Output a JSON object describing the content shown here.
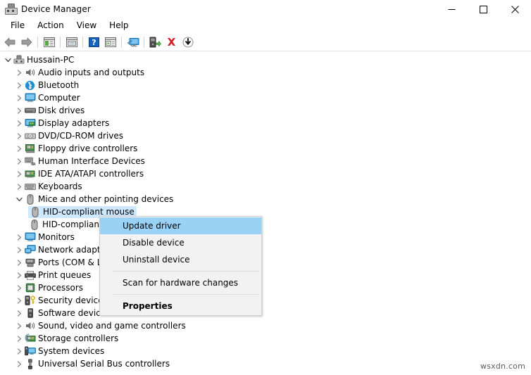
{
  "window": {
    "title": "Device Manager",
    "icon": "device-manager-icon",
    "controls": {
      "minimize": "minimize-icon",
      "maximize": "maximize-icon",
      "close": "close-icon"
    }
  },
  "menubar": {
    "items": [
      {
        "label": "File"
      },
      {
        "label": "Action"
      },
      {
        "label": "View"
      },
      {
        "label": "Help"
      }
    ]
  },
  "toolbar": {
    "buttons": [
      {
        "name": "back-arrow-icon",
        "type": "back"
      },
      {
        "name": "forward-arrow-icon",
        "type": "forward"
      },
      {
        "name": "separator-1",
        "type": "sep"
      },
      {
        "name": "show-hidden-devices-icon",
        "type": "list-green"
      },
      {
        "name": "separator-2",
        "type": "sep"
      },
      {
        "name": "properties-icon",
        "type": "properties"
      },
      {
        "name": "separator-3",
        "type": "sep"
      },
      {
        "name": "help-icon",
        "type": "help"
      },
      {
        "name": "view-devices-icon",
        "type": "list-play"
      },
      {
        "name": "separator-4",
        "type": "sep"
      },
      {
        "name": "scan-for-hardware-changes-icon",
        "type": "monitor-scan"
      },
      {
        "name": "separator-5",
        "type": "sep"
      },
      {
        "name": "update-driver-icon",
        "type": "update-driver"
      },
      {
        "name": "uninstall-device-icon",
        "type": "red-x"
      },
      {
        "name": "disable-device-icon",
        "type": "down-arrow"
      }
    ]
  },
  "tree": {
    "root": {
      "label": "Hussain-PC",
      "icon": "computer-node-icon",
      "expanded": true
    },
    "nodes": [
      {
        "label": "Audio inputs and outputs",
        "icon": "speaker-icon",
        "depth": 1,
        "expanded": false
      },
      {
        "label": "Bluetooth",
        "icon": "bluetooth-icon",
        "depth": 1,
        "expanded": false
      },
      {
        "label": "Computer",
        "icon": "monitor-icon",
        "depth": 1,
        "expanded": false
      },
      {
        "label": "Disk drives",
        "icon": "disk-drive-icon",
        "depth": 1,
        "expanded": false
      },
      {
        "label": "Display adapters",
        "icon": "display-adapter-icon",
        "depth": 1,
        "expanded": false
      },
      {
        "label": "DVD/CD-ROM drives",
        "icon": "dvd-drive-icon",
        "depth": 1,
        "expanded": false
      },
      {
        "label": "Floppy drive controllers",
        "icon": "floppy-controller-icon",
        "depth": 1,
        "expanded": false
      },
      {
        "label": "Human Interface Devices",
        "icon": "hid-icon",
        "depth": 1,
        "expanded": false
      },
      {
        "label": "IDE ATA/ATAPI controllers",
        "icon": "ide-controller-icon",
        "depth": 1,
        "expanded": false
      },
      {
        "label": "Keyboards",
        "icon": "keyboard-icon",
        "depth": 1,
        "expanded": false
      },
      {
        "label": "Mice and other pointing devices",
        "icon": "mouse-icon",
        "depth": 1,
        "expanded": true
      },
      {
        "label": "HID-compliant mouse",
        "icon": "mouse-icon",
        "depth": 2,
        "expanded": false,
        "selected": true
      },
      {
        "label": "HID-compliant mouse",
        "icon": "mouse-icon",
        "depth": 2,
        "expanded": false
      },
      {
        "label": "Monitors",
        "icon": "monitor-icon",
        "depth": 1,
        "expanded": false
      },
      {
        "label": "Network adapters",
        "icon": "network-adapter-icon",
        "depth": 1,
        "expanded": false
      },
      {
        "label": "Ports (COM & LPT)",
        "icon": "port-icon",
        "depth": 1,
        "expanded": false
      },
      {
        "label": "Print queues",
        "icon": "printer-icon",
        "depth": 1,
        "expanded": false
      },
      {
        "label": "Processors",
        "icon": "processor-icon",
        "depth": 1,
        "expanded": false
      },
      {
        "label": "Security devices",
        "icon": "security-device-icon",
        "depth": 1,
        "expanded": false
      },
      {
        "label": "Software devices",
        "icon": "software-device-icon",
        "depth": 1,
        "expanded": false
      },
      {
        "label": "Sound, video and game controllers",
        "icon": "speaker-icon",
        "depth": 1,
        "expanded": false
      },
      {
        "label": "Storage controllers",
        "icon": "storage-controller-icon",
        "depth": 1,
        "expanded": false
      },
      {
        "label": "System devices",
        "icon": "system-device-icon",
        "depth": 1,
        "expanded": false
      },
      {
        "label": "Universal Serial Bus controllers",
        "icon": "usb-icon",
        "depth": 1,
        "expanded": false
      }
    ]
  },
  "context_menu": {
    "items": [
      {
        "label": "Update driver",
        "highlight": true,
        "bold": false
      },
      {
        "label": "Disable device",
        "highlight": false,
        "bold": false
      },
      {
        "label": "Uninstall device",
        "highlight": false,
        "bold": false
      },
      {
        "label": "__sep__"
      },
      {
        "label": "Scan for hardware changes",
        "highlight": false,
        "bold": false
      },
      {
        "label": "__sep__"
      },
      {
        "label": "Properties",
        "highlight": false,
        "bold": true
      }
    ]
  },
  "watermark": {
    "text": "wsxdn.com"
  },
  "colors": {
    "menu_highlight": "#9ad2f5",
    "tree_selection": "#cde8ff",
    "menu_background": "#f2f2f2",
    "accent_blue": "#0078d7"
  }
}
